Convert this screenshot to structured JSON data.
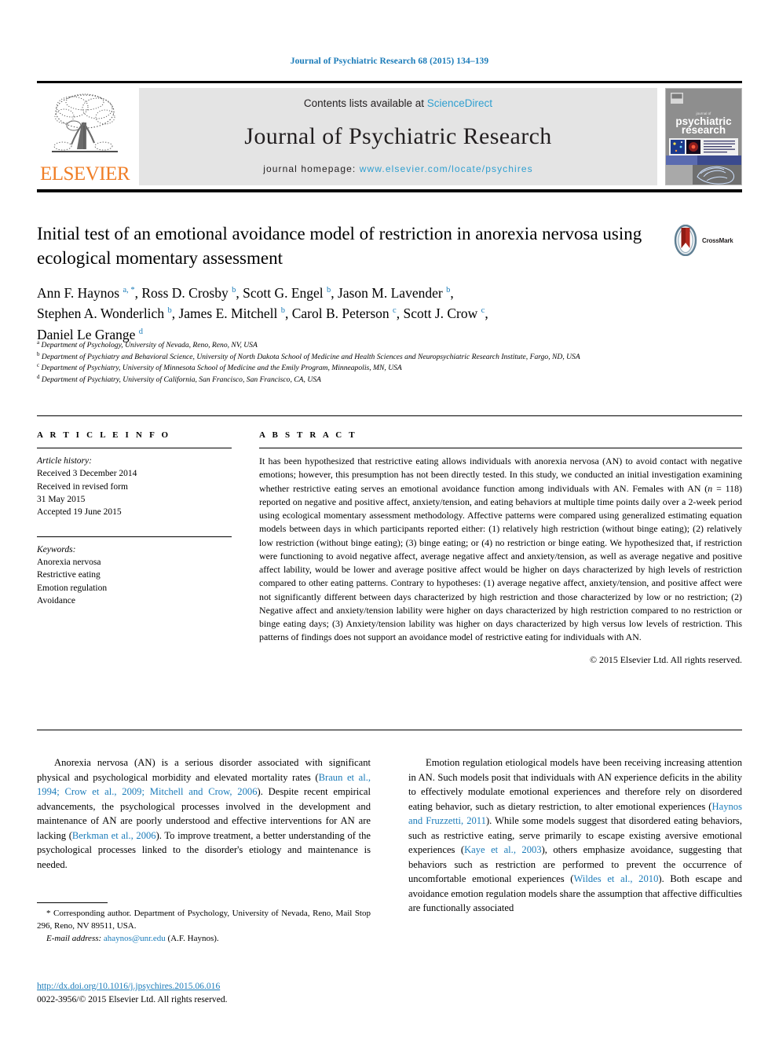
{
  "running_head": "Journal of Psychiatric Research 68 (2015) 134–139",
  "masthead": {
    "publisher": "ELSEVIER",
    "contents_prefix": "Contents lists available at",
    "contents_link": "ScienceDirect",
    "journal_title": "Journal of Psychiatric Research",
    "homepage_prefix": "journal homepage:",
    "homepage_url": "www.elsevier.com/locate/psychires",
    "cover_line1": "psychiatric",
    "cover_line2": "research",
    "cover_kicker": "journal of",
    "link_color": "#2f9fd0"
  },
  "article": {
    "title": "Initial test of an emotional avoidance model of restriction in anorexia nervosa using ecological momentary assessment",
    "crossmark_label": "CrossMark"
  },
  "authors": {
    "line1": "Ann F. Haynos <sup>a, *</sup>, Ross D. Crosby <sup>b</sup>, Scott G. Engel <sup>b</sup>, Jason M. Lavender <sup>b</sup>,",
    "line2": "Stephen A. Wonderlich <sup>b</sup>, James E. Mitchell <sup>b</sup>, Carol B. Peterson <sup>c</sup>, Scott J. Crow <sup>c</sup>,",
    "line3": "Daniel Le Grange <sup>d</sup>"
  },
  "affiliations": [
    {
      "marker": "a",
      "text": "Department of Psychology, University of Nevada, Reno, Reno, NV, USA"
    },
    {
      "marker": "b",
      "text": "Department of Psychiatry and Behavioral Science, University of North Dakota School of Medicine and Health Sciences and Neuropsychiatric Research Institute, Fargo, ND, USA"
    },
    {
      "marker": "c",
      "text": "Department of Psychiatry, University of Minnesota School of Medicine and the Emily Program, Minneapolis, MN, USA"
    },
    {
      "marker": "d",
      "text": "Department of Psychiatry, University of California, San Francisco, San Francisco, CA, USA"
    }
  ],
  "article_info": {
    "heading": "A R T I C L E   I N F O",
    "history_label": "Article history:",
    "history": [
      "Received 3 December 2014",
      "Received in revised form",
      "31 May 2015",
      "Accepted 19 June 2015"
    ],
    "keywords_label": "Keywords:",
    "keywords": [
      "Anorexia nervosa",
      "Restrictive eating",
      "Emotion regulation",
      "Avoidance"
    ]
  },
  "abstract": {
    "heading": "A B S T R A C T",
    "text": "It has been hypothesized that restrictive eating allows individuals with anorexia nervosa (AN) to avoid contact with negative emotions; however, this presumption has not been directly tested. In this study, we conducted an initial investigation examining whether restrictive eating serves an emotional avoidance function among individuals with AN. Females with AN (n = 118) reported on negative and positive affect, anxiety/tension, and eating behaviors at multiple time points daily over a 2-week period using ecological momentary assessment methodology. Affective patterns were compared using generalized estimating equation models between days in which participants reported either: (1) relatively high restriction (without binge eating); (2) relatively low restriction (without binge eating); (3) binge eating; or (4) no restriction or binge eating. We hypothesized that, if restriction were functioning to avoid negative affect, average negative affect and anxiety/tension, as well as average negative and positive affect lability, would be lower and average positive affect would be higher on days characterized by high levels of restriction compared to other eating patterns. Contrary to hypotheses: (1) average negative affect, anxiety/tension, and positive affect were not significantly different between days characterized by high restriction and those characterized by low or no restriction; (2) Negative affect and anxiety/tension lability were higher on days characterized by high restriction compared to no restriction or binge eating days; (3) Anxiety/tension lability was higher on days characterized by high versus low levels of restriction. This patterns of findings does not support an avoidance model of restrictive eating for individuals with AN.",
    "copyright": "© 2015 Elsevier Ltd. All rights reserved."
  },
  "body": {
    "left_paragraph_html": "Anorexia nervosa (AN) is a serious disorder associated with significant physical and psychological morbidity and elevated mortality rates (<span class=\"cite\">Braun et al., 1994; Crow et al., 2009; Mitchell and Crow, 2006</span>). Despite recent empirical advancements, the psychological processes involved in the development and maintenance of AN are poorly understood and effective interventions for AN are lacking (<span class=\"cite\">Berkman et al., 2006</span>). To improve treatment, a better understanding of the psychological processes linked to the disorder's etiology and maintenance is needed.",
    "right_paragraph_html": "Emotion regulation etiological models have been receiving increasing attention in AN. Such models posit that individuals with AN experience deficits in the ability to effectively modulate emotional experiences and therefore rely on disordered eating behavior, such as dietary restriction, to alter emotional experiences (<span class=\"cite\">Haynos and Fruzzetti, 2011</span>). While some models suggest that disordered eating behaviors, such as restrictive eating, serve primarily to escape existing aversive emotional experiences (<span class=\"cite\">Kaye et al., 2003</span>), others emphasize avoidance, suggesting that behaviors such as restriction are performed to prevent the occurrence of uncomfortable emotional experiences (<span class=\"cite\">Wildes et al., 2010</span>). Both escape and avoidance emotion regulation models share the assumption that affective difficulties are functionally associated"
  },
  "footnote": {
    "corresponding_html": "* Corresponding author. Department of Psychology, University of Nevada, Reno, Mail Stop 296, Reno, NV 89511, USA.",
    "email_label": "E-mail address:",
    "email": "ahaynos@unr.edu",
    "email_suffix": "(A.F. Haynos)."
  },
  "footer": {
    "doi": "http://dx.doi.org/10.1016/j.jpsychires.2015.06.016",
    "issn_line": "0022-3956/© 2015 Elsevier Ltd. All rights reserved."
  }
}
